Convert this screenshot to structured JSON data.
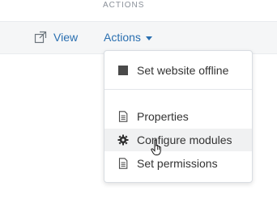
{
  "header": {
    "label": "ACTIONS"
  },
  "toolbar": {
    "view_label": "View",
    "view_icon": "external-link-icon",
    "actions_label": "Actions"
  },
  "dropdown": {
    "items": [
      {
        "label": "Set website offline",
        "icon": "square-icon"
      },
      {
        "label": "Properties",
        "icon": "document-icon"
      },
      {
        "label": "Configure modules",
        "icon": "gear-icon"
      },
      {
        "label": "Set permissions",
        "icon": "document-icon"
      }
    ]
  },
  "colors": {
    "link": "#2a6fb0",
    "text": "#333333",
    "header_text": "#8a9099",
    "row_bg": "#f5f6f7",
    "hover_bg": "#f0f1f2"
  }
}
